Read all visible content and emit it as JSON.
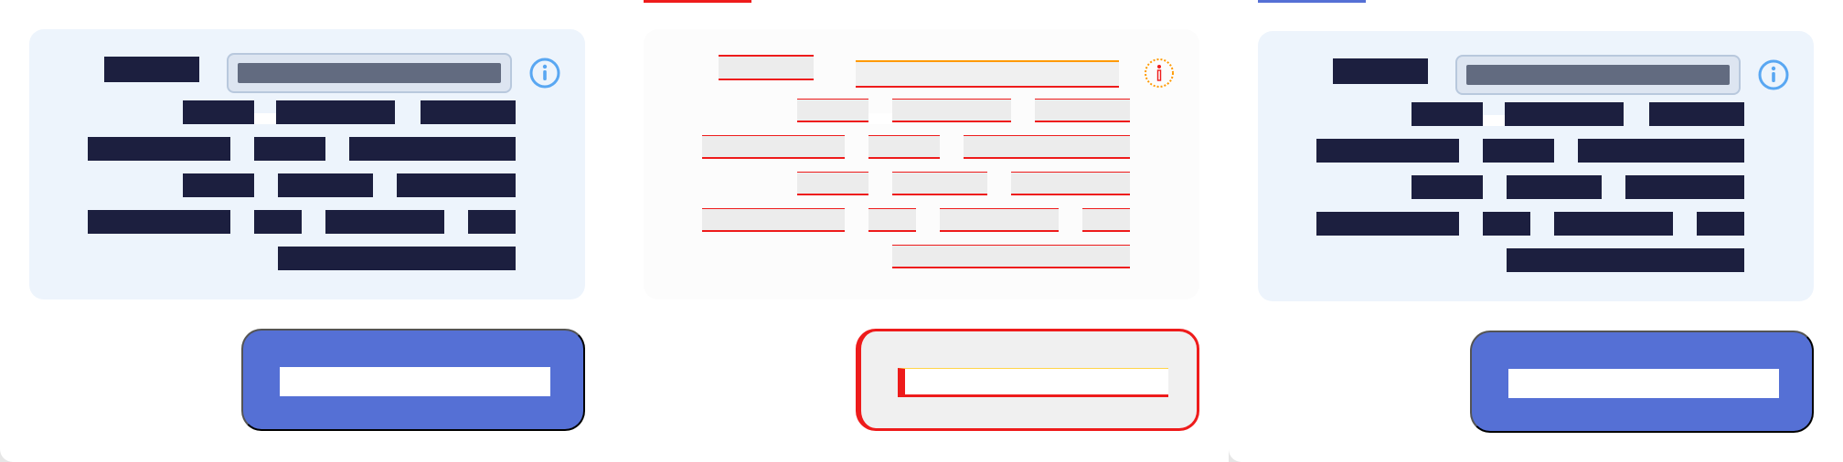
{
  "panels": [
    {
      "variant": "normal",
      "title": "",
      "field_value": "",
      "button_label": "",
      "accent": "#5570d5"
    },
    {
      "variant": "debug",
      "title": "",
      "field_value": "",
      "button_label": "",
      "accent": "#ee1b1b"
    },
    {
      "variant": "normal",
      "title": "",
      "field_value": "",
      "button_label": "",
      "accent": "#5570d5"
    }
  ],
  "theme": {
    "card_bg": "#edf4fc",
    "text_block": "#1c1f3f",
    "primary": "#5570d5",
    "field": "#626b80",
    "info": "#59a7f2",
    "debug_red": "#ee1b1b"
  },
  "icons": {
    "info": "info-icon"
  }
}
